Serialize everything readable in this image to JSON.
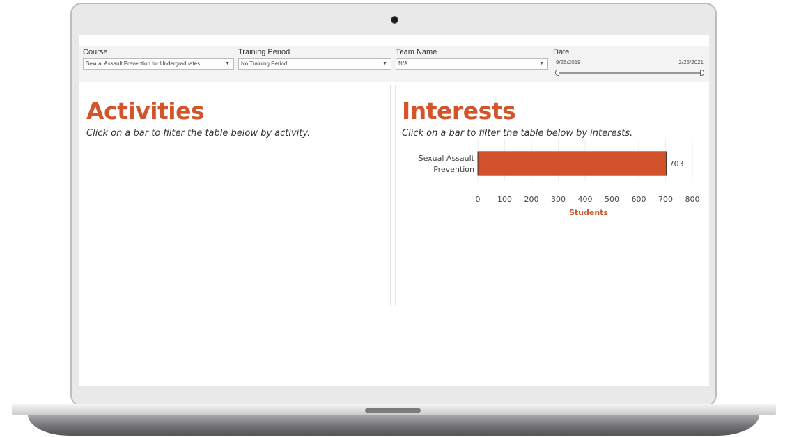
{
  "filters": {
    "course": {
      "label": "Course",
      "value": "Sexual Assault Prevention for Undergraduates"
    },
    "training_period": {
      "label": "Training Period",
      "value": "No Training Period"
    },
    "team_name": {
      "label": "Team Name",
      "value": "N/A"
    },
    "date": {
      "label": "Date",
      "start": "9/26/2019",
      "end": "2/25/2021"
    }
  },
  "activities": {
    "title": "Activities",
    "subtitle": "Click on a bar to filter the table below by activity."
  },
  "interests": {
    "title": "Interests",
    "subtitle": "Click on a bar to filter the table below by interests."
  },
  "colors": {
    "accent": "#d3542a",
    "bar_fill": "#d1522a",
    "bar_stroke": "#333333"
  },
  "chart_data": {
    "type": "bar",
    "orientation": "horizontal",
    "categories": [
      [
        "Sexual Assault",
        "Prevention"
      ]
    ],
    "values": [
      703
    ],
    "data_labels": [
      "703"
    ],
    "xlabel": "Students",
    "ylabel": "",
    "xlim": [
      0,
      800
    ],
    "xticks": [
      0,
      100,
      200,
      300,
      400,
      500,
      600,
      700,
      800
    ],
    "grid": true
  }
}
